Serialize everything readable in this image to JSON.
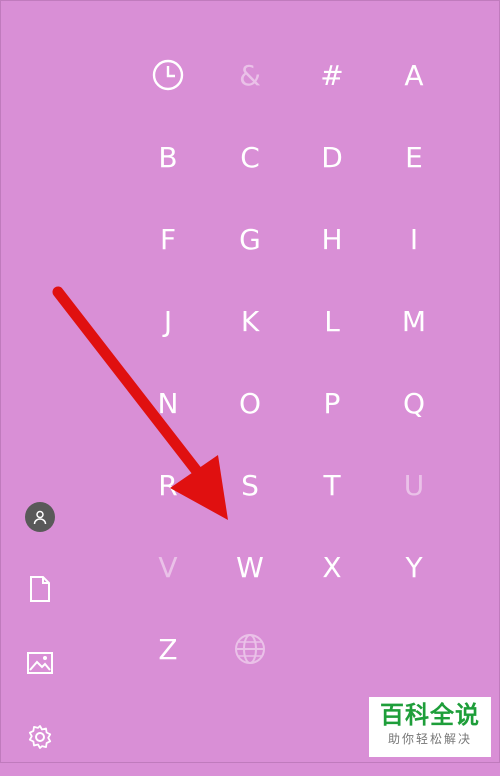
{
  "colors": {
    "background": "#d98fd6",
    "text": "#ffffff",
    "arrow": "#e01010",
    "watermark_green": "#1e9e3a"
  },
  "jump_list": {
    "rows": [
      [
        {
          "key": "recent",
          "icon": "clock-icon",
          "enabled": true
        },
        {
          "key": "&",
          "label": "&",
          "enabled": false
        },
        {
          "key": "#",
          "label": "#",
          "enabled": true
        },
        {
          "key": "A",
          "label": "A",
          "enabled": true
        }
      ],
      [
        {
          "key": "B",
          "label": "B",
          "enabled": true
        },
        {
          "key": "C",
          "label": "C",
          "enabled": true
        },
        {
          "key": "D",
          "label": "D",
          "enabled": true
        },
        {
          "key": "E",
          "label": "E",
          "enabled": true
        }
      ],
      [
        {
          "key": "F",
          "label": "F",
          "enabled": true
        },
        {
          "key": "G",
          "label": "G",
          "enabled": true
        },
        {
          "key": "H",
          "label": "H",
          "enabled": true
        },
        {
          "key": "I",
          "label": "I",
          "enabled": true
        }
      ],
      [
        {
          "key": "J",
          "label": "J",
          "enabled": true
        },
        {
          "key": "K",
          "label": "K",
          "enabled": true
        },
        {
          "key": "L",
          "label": "L",
          "enabled": true
        },
        {
          "key": "M",
          "label": "M",
          "enabled": true
        }
      ],
      [
        {
          "key": "N",
          "label": "N",
          "enabled": true
        },
        {
          "key": "O",
          "label": "O",
          "enabled": true
        },
        {
          "key": "P",
          "label": "P",
          "enabled": true
        },
        {
          "key": "Q",
          "label": "Q",
          "enabled": true
        }
      ],
      [
        {
          "key": "R",
          "label": "R",
          "enabled": true
        },
        {
          "key": "S",
          "label": "S",
          "enabled": true
        },
        {
          "key": "T",
          "label": "T",
          "enabled": true
        },
        {
          "key": "U",
          "label": "U",
          "enabled": false
        }
      ],
      [
        {
          "key": "V",
          "label": "V",
          "enabled": false
        },
        {
          "key": "W",
          "label": "W",
          "enabled": true
        },
        {
          "key": "X",
          "label": "X",
          "enabled": true
        },
        {
          "key": "Y",
          "label": "Y",
          "enabled": true
        }
      ],
      [
        {
          "key": "Z",
          "label": "Z",
          "enabled": true
        },
        {
          "key": "globe",
          "icon": "globe-icon",
          "enabled": false
        }
      ]
    ]
  },
  "left_rail": [
    {
      "name": "user-account-button",
      "icon": "user-icon"
    },
    {
      "name": "documents-button",
      "icon": "document-icon"
    },
    {
      "name": "pictures-button",
      "icon": "picture-icon"
    },
    {
      "name": "settings-button",
      "icon": "gear-icon"
    }
  ],
  "annotation": {
    "icon": "red-arrow-icon"
  },
  "watermark": {
    "title": "百科全说",
    "subtitle": "助你轻松解决"
  }
}
